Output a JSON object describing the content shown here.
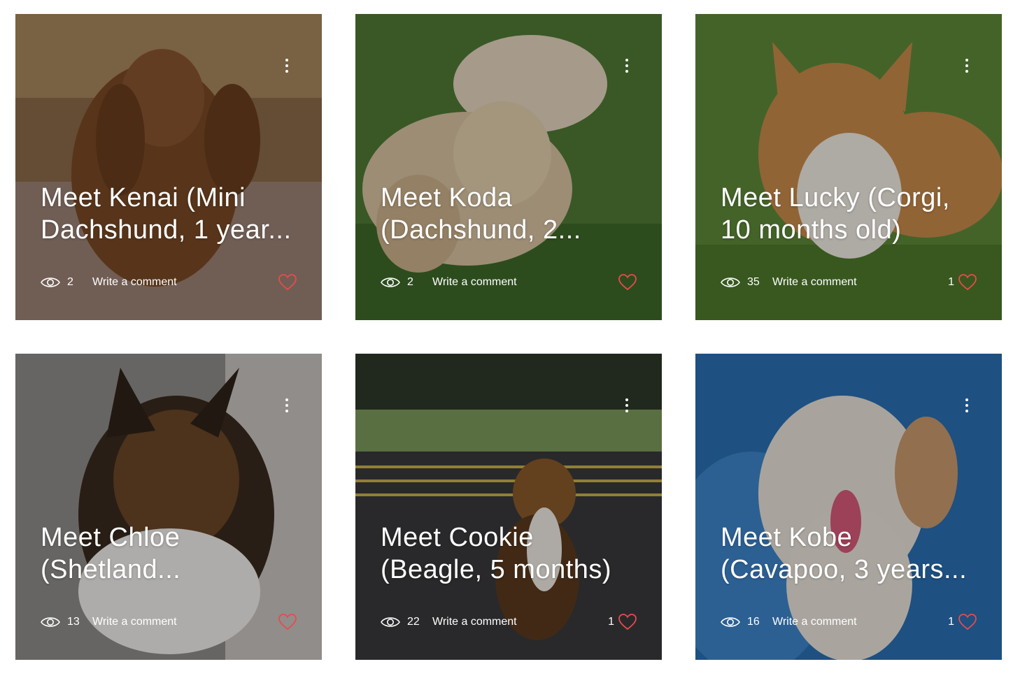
{
  "colors": {
    "heart": "#e84b4b",
    "text": "#ffffff",
    "overlay": "rgba(0,0,0,0.28)"
  },
  "icons": {
    "views": "eye-icon",
    "like": "heart-icon",
    "menu": "more-vertical-icon"
  },
  "posts": [
    {
      "title": "Meet Kenai (Mini\nDachshund, 1 year...",
      "views": "2",
      "comment_label": "Write a comment",
      "likes": ""
    },
    {
      "title": "Meet Koda\n(Dachshund, 2...",
      "views": "2",
      "comment_label": "Write a comment",
      "likes": ""
    },
    {
      "title": "Meet Lucky (Corgi,\n10 months old)",
      "views": "35",
      "comment_label": "Write a comment",
      "likes": "1"
    },
    {
      "title": "Meet Chloe\n(Shetland...",
      "views": "13",
      "comment_label": "Write a comment",
      "likes": ""
    },
    {
      "title": "Meet Cookie\n(Beagle, 5 months)",
      "views": "22",
      "comment_label": "Write a comment",
      "likes": "1"
    },
    {
      "title": "Meet Kobe\n(Cavapoo, 3 years...",
      "views": "16",
      "comment_label": "Write a comment",
      "likes": "1"
    }
  ]
}
